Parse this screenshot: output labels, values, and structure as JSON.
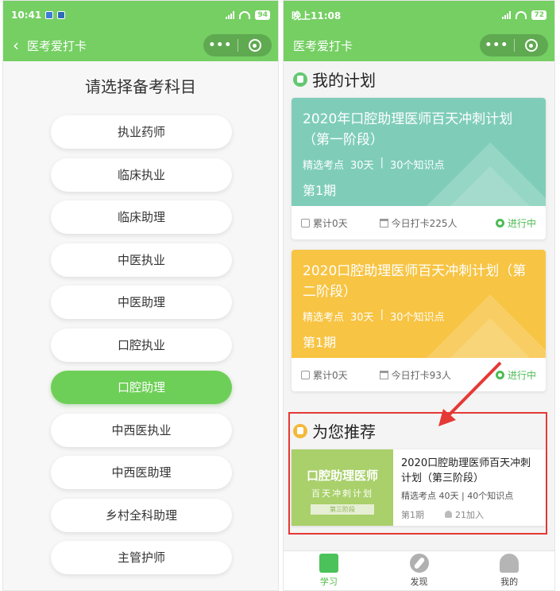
{
  "left_screen": {
    "status": {
      "time": "10:41",
      "battery": "94"
    },
    "nav": {
      "back_icon": "‹",
      "title": "医考爱打卡",
      "menu_dots": "•••"
    },
    "title": "请选择备考科目",
    "subjects": [
      "执业药师",
      "临床执业",
      "临床助理",
      "中医执业",
      "中医助理",
      "口腔执业",
      "口腔助理",
      "中西医执业",
      "中西医助理",
      "乡村全科助理",
      "主管护师"
    ],
    "selected_subject": "口腔助理"
  },
  "right_screen": {
    "status": {
      "time": "晚上11:08",
      "battery": "72"
    },
    "nav": {
      "title": "医考爱打卡",
      "menu_dots": "•••"
    },
    "my_plan": {
      "heading": "我的计划",
      "cards": [
        {
          "title": "2020年口腔助理医师百天冲刺计划（第一阶段）",
          "tag": "精选考点",
          "days": "30天",
          "divider": "|",
          "points": "30个知识点",
          "period": "第1期",
          "accumulated": "累计0天",
          "today": "今日打卡225人",
          "status": "进行中",
          "color": "#7fcdb9"
        },
        {
          "title": "2020口腔助理医师百天冲刺计划（第二阶段）",
          "tag": "精选考点",
          "days": "30天",
          "divider": "|",
          "points": "30个知识点",
          "period": "第1期",
          "accumulated": "累计0天",
          "today": "今日打卡93人",
          "status": "进行中",
          "color": "#f7c443"
        }
      ]
    },
    "recommend": {
      "heading": "为您推荐",
      "thumb_title": "口腔助理医师",
      "thumb_sub": "百天冲刺计划",
      "thumb_tag": "第三阶段",
      "title": "2020口腔助理医师百天冲刺计划（第三阶段）",
      "meta": "精选考点  40天 | 40个知识点",
      "period": "第1期",
      "joined": "21加入"
    },
    "tabbar": [
      {
        "label": "学习",
        "icon": "book-icon",
        "active": true
      },
      {
        "label": "发现",
        "icon": "compass-icon",
        "active": false
      },
      {
        "label": "我的",
        "icon": "person-icon",
        "active": false
      }
    ]
  },
  "colors": {
    "brand_green": "#75cf63",
    "highlight_red": "#e53935"
  }
}
